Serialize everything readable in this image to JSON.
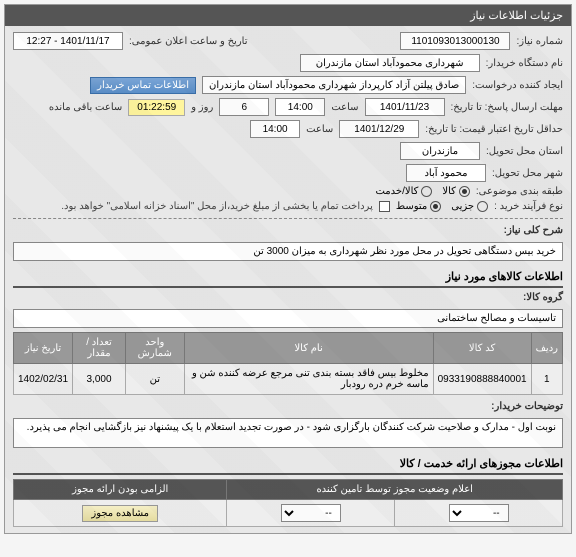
{
  "panel_title": "جزئیات اطلاعات نیاز",
  "req_number_label": "شماره نیاز:",
  "req_number": "1101093013000130",
  "announce_label": "تاریخ و ساعت اعلان عمومی:",
  "announce_value": "1401/11/17 - 12:27",
  "buyer_label": "نام دستگاه خریدار:",
  "buyer_value": "شهرداری محمودآباد استان مازندران",
  "creator_label": "ایجاد کننده درخواست:",
  "creator_value": "صادق پیلتن آزاد کارپرداز شهرداری محمودآباد استان مازندران",
  "contact_btn": "اطلاعات تماس خریدار",
  "deadline_label": "مهلت ارسال پاسخ: تا تاریخ:",
  "deadline_date": "1401/11/23",
  "time_label": "ساعت",
  "deadline_time": "14:00",
  "days_label": "روز و",
  "days_value": "6",
  "countdown": "01:22:59",
  "remaining_label": "ساعت باقی مانده",
  "validity_label": "حداقل تاریخ اعتبار قیمت: تا تاریخ:",
  "validity_date": "1401/12/29",
  "validity_time": "14:00",
  "delivery_prov_label": "استان محل تحویل:",
  "delivery_prov": "مازندران",
  "delivery_city_label": "شهر محل تحویل:",
  "delivery_city": "محمود آباد",
  "category_label": "طبقه بندی موضوعی:",
  "cat_goods": "کالا",
  "cat_service": "کالا/خدمت",
  "process_label": "نوع فرآیند خرید :",
  "proc_low": "جزیی",
  "proc_mid": "متوسط",
  "payment_note": "پرداخت تمام یا بخشی از مبلغ خرید،از محل \"اسناد خزانه اسلامی\" خواهد بود.",
  "desc_label": "شرح کلی نیاز:",
  "desc_value": "خرید بیس دستگاهی تحویل در محل مورد نظر شهرداری به میزان 3000 تن",
  "items_title": "اطلاعات کالاهای مورد نیاز",
  "group_label": "گروه کالا:",
  "group_value": "تاسیسات و مصالح ساختمانی",
  "th_row": "ردیف",
  "th_code": "کد کالا",
  "th_name": "نام کالا",
  "th_unit": "واحد شمارش",
  "th_qty": "تعداد / مقدار",
  "th_date": "تاریخ نیاز",
  "item": {
    "row": "1",
    "code": "0933190888840001",
    "name": "مخلوط بیس فاقد بسته بندی تنی مرجع عرضه کننده شن و ماسه خرم دره رودبار",
    "unit": "تن",
    "qty": "3,000",
    "date": "1402/02/31"
  },
  "buyer_notes_label": "توضیحات خریدار:",
  "buyer_notes": "نوبت اول -  مدارک و صلاحیت شرکت کنندگان بارگزاری شود - در صورت تجدید استعلام با یک پیشنهاد نیز بازگشایی انجام می پذیرد.",
  "permits_title": "اطلاعات مجوزهای ارائه خدمت / کالا",
  "permit_status_header": "اعلام وضعیت مجوز توسط تامین کننده",
  "mandatory_header": "الزامی بودن ارائه مجوز",
  "select_placeholder": "--",
  "view_permit_btn": "مشاهده مجوز"
}
